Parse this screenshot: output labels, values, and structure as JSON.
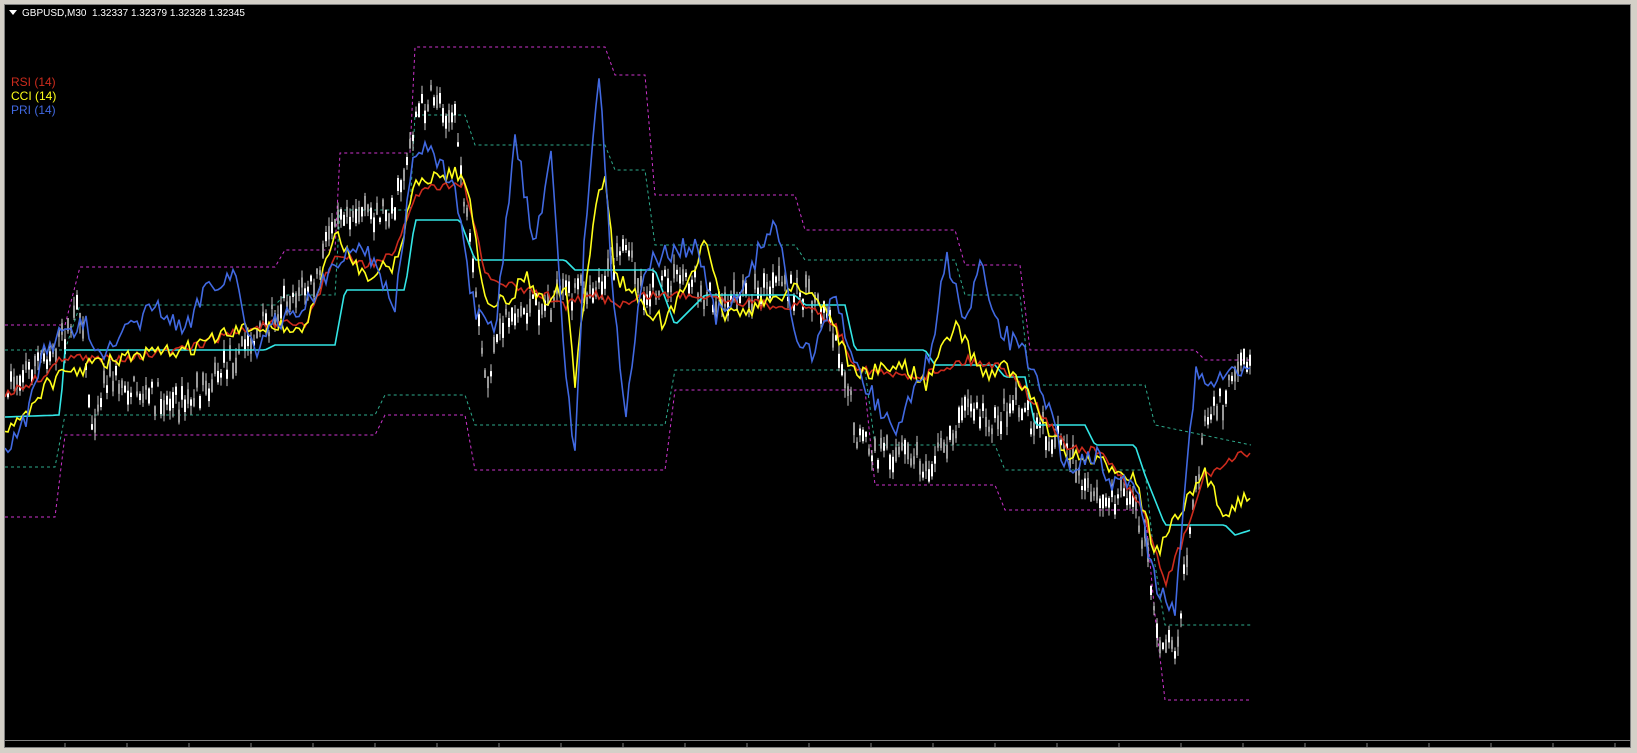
{
  "header": {
    "symbol": "GBPUSD,M30",
    "quotes": "1.32337 1.32379 1.32328 1.32345"
  },
  "legend": [
    {
      "label": "RSI (14)",
      "color": "#cc2b1d"
    },
    {
      "label": "CCI (14)",
      "color": "#ffff1a"
    },
    {
      "label": "PRI (14)",
      "color": "#4169e1"
    }
  ],
  "colors": {
    "background": "#000000",
    "candles": "#c8c8c8",
    "rsi": "#cc2b1d",
    "cci": "#ffff1a",
    "pri": "#4169e1",
    "midline": "#33e6e6",
    "upper_band": "#cc33cc",
    "inner_band": "#2eaa8c"
  },
  "icons": {
    "dropdown": "chevron-down-icon"
  }
}
